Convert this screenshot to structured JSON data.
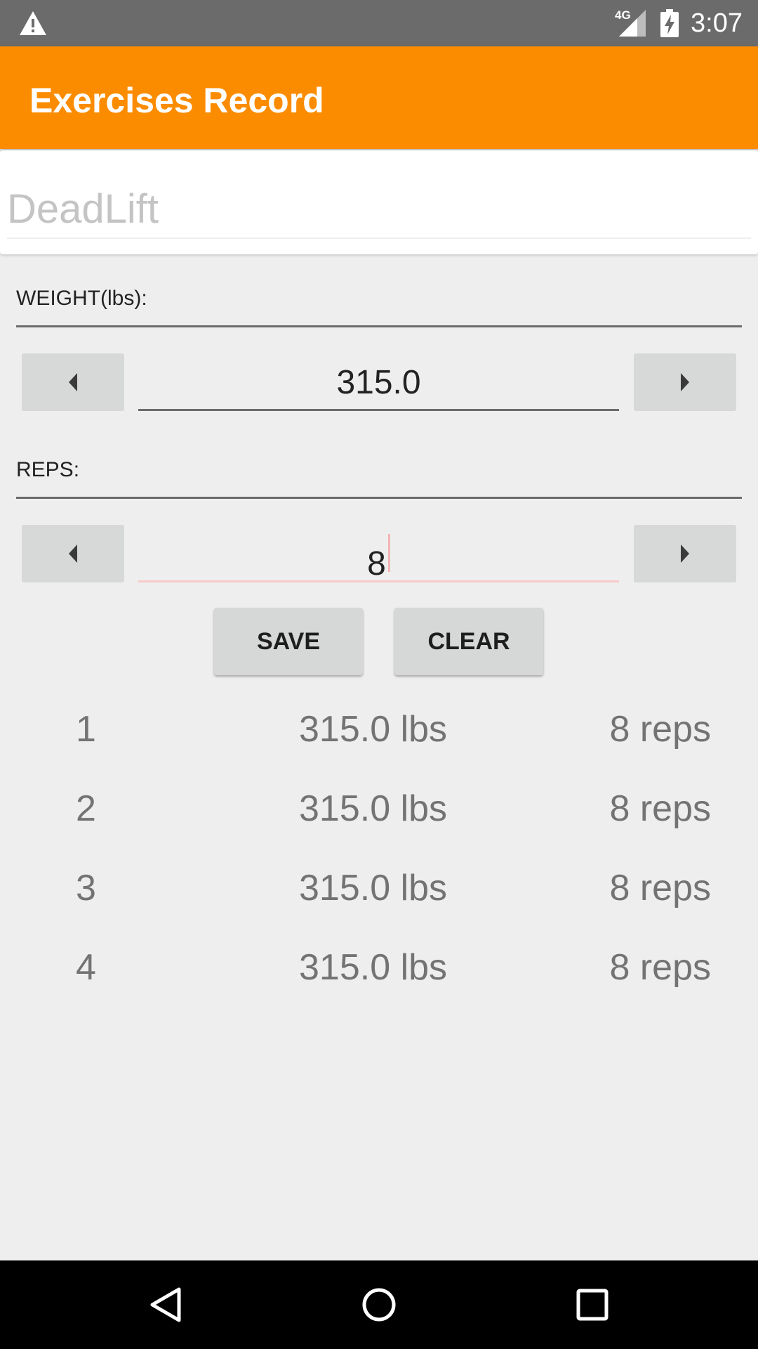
{
  "status_bar": {
    "network": "4G",
    "time": "3:07",
    "icons": [
      "warning-icon",
      "signal-icon",
      "battery-charging-icon"
    ]
  },
  "app_bar": {
    "title": "Exercises Record"
  },
  "exercise": {
    "name": "DeadLift"
  },
  "weight": {
    "label": "WEIGHT(lbs):",
    "value": "315.0",
    "decrement_icon": "triangle-left-icon",
    "increment_icon": "triangle-right-icon"
  },
  "reps": {
    "label": "REPS:",
    "value": "8",
    "decrement_icon": "triangle-left-icon",
    "increment_icon": "triangle-right-icon"
  },
  "actions": {
    "save_label": "SAVE",
    "clear_label": "CLEAR"
  },
  "records": [
    {
      "num": "1",
      "weight": "315.0 lbs",
      "reps": "8 reps"
    },
    {
      "num": "2",
      "weight": "315.0 lbs",
      "reps": "8 reps"
    },
    {
      "num": "3",
      "weight": "315.0 lbs",
      "reps": "8 reps"
    },
    {
      "num": "4",
      "weight": "315.0 lbs",
      "reps": "8 reps"
    }
  ],
  "nav_bar": {
    "icons": [
      "back-icon",
      "home-icon",
      "recents-icon"
    ]
  },
  "colors": {
    "app_bar": "#fb8c00",
    "status_bar": "#6b6b6b",
    "background": "#eeeeee",
    "button": "#d7d8d8",
    "focused_underline": "#f8c9c9"
  }
}
